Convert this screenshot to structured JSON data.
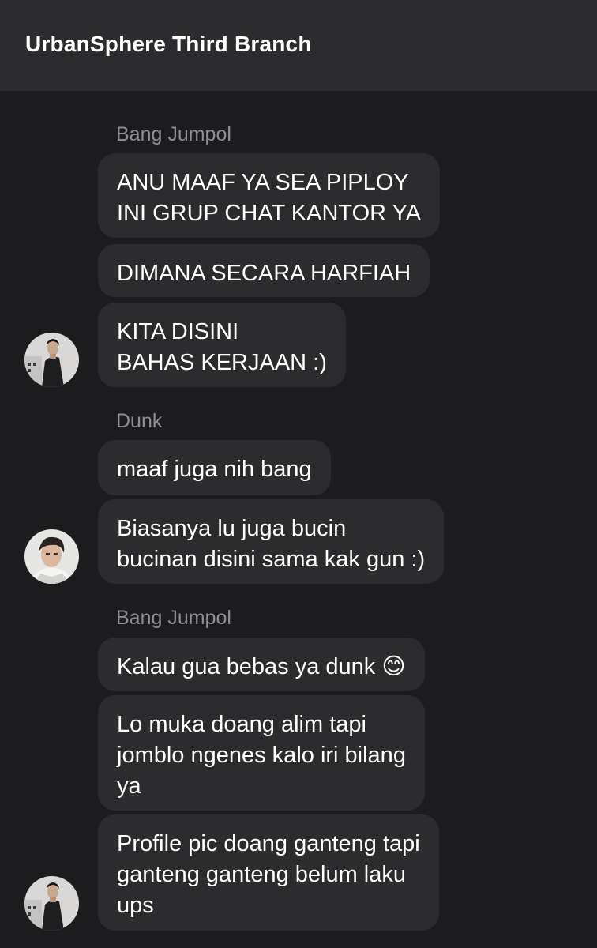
{
  "header": {
    "title": "UrbanSphere Third Branch"
  },
  "groups": [
    {
      "sender": "Bang Jumpol",
      "avatar_icon": "person-avatar-icon",
      "messages": [
        "ANU MAAF YA SEA PIPLOY\nINI GRUP CHAT KANTOR YA",
        "DIMANA SECARA HARFIAH",
        "KITA DISINI\nBAHAS KERJAAN :)"
      ]
    },
    {
      "sender": "Dunk",
      "avatar_icon": "person-avatar-icon",
      "messages": [
        "maaf juga nih bang",
        "Biasanya lu juga bucin\nbucinan disini sama kak gun :)"
      ]
    },
    {
      "sender": "Bang Jumpol",
      "avatar_icon": "person-avatar-icon",
      "messages": [
        "Kalau gua bebas ya dunk 😊",
        "Lo muka doang alim tapi\njomblo ngenes kalo iri bilang\nya",
        "Profile pic doang ganteng tapi\nganteng ganteng belum laku\nups"
      ]
    }
  ]
}
